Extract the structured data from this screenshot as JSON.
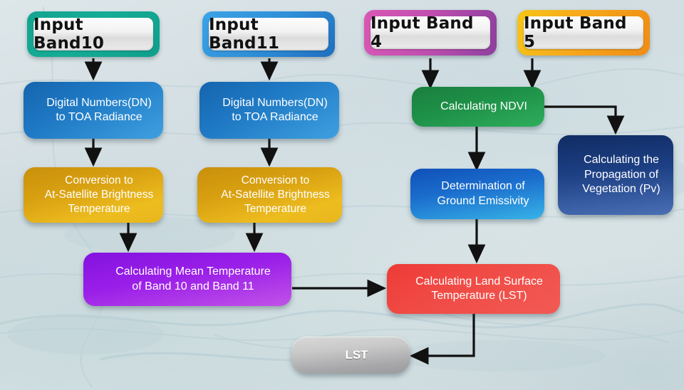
{
  "diagram": {
    "title": "Land Surface Temperature (LST) retrieval workflow",
    "background": "faded satellite basemap, pale blue-gray",
    "colors": {
      "frame_green": "#15ac95",
      "frame_blue": "#2f8fd8",
      "frame_magenta": "#c24fb0",
      "frame_orange": "#f7a81b",
      "node_blue": "#1f79c4",
      "node_gold": "#d79f10",
      "node_purple": "#9a1fe8",
      "node_green": "#1e9148",
      "node_emissivity": "#1a6ccc",
      "node_pv": "#1d3f84",
      "node_red": "#f04a45",
      "node_gray": "#b0b0b2",
      "arrow": "#111111"
    },
    "inputs": [
      {
        "id": "band10",
        "label": "Input Band10",
        "frame": "green"
      },
      {
        "id": "band11",
        "label": "Input Band11",
        "frame": "blue"
      },
      {
        "id": "band4",
        "label": "Input Band 4",
        "frame": "magenta"
      },
      {
        "id": "band5",
        "label": "Input Band 5",
        "frame": "orange"
      }
    ],
    "nodes": [
      {
        "id": "dn10",
        "line1": "Digital Numbers(DN)",
        "line2": "to TOA Radiance",
        "line3": ""
      },
      {
        "id": "dn11",
        "line1": "Digital Numbers(DN)",
        "line2": "to TOA Radiance",
        "line3": ""
      },
      {
        "id": "bt10",
        "line1": "Conversion to",
        "line2": "At-Satellite Brightness",
        "line3": "Temperature"
      },
      {
        "id": "bt11",
        "line1": "Conversion to",
        "line2": "At-Satellite Brightness",
        "line3": "Temperature"
      },
      {
        "id": "ndvi",
        "line1": "Calculating NDVI",
        "line2": "",
        "line3": ""
      },
      {
        "id": "pv",
        "line1": "Calculating the",
        "line2": "Propagation of",
        "line3": "Vegetation (Pv)"
      },
      {
        "id": "emissivity",
        "line1": "Determination of",
        "line2": "Ground Emissivity",
        "line3": ""
      },
      {
        "id": "meantemp",
        "line1": "Calculating Mean Temperature",
        "line2": "of Band 10 and Band 11",
        "line3": ""
      },
      {
        "id": "lstcalc",
        "line1": "Calculating Land Surface",
        "line2": "Temperature (LST)",
        "line3": ""
      },
      {
        "id": "lstout",
        "line1": "LST",
        "line2": "",
        "line3": ""
      }
    ],
    "edges": [
      {
        "from": "band10",
        "to": "dn10",
        "style": "straight-down"
      },
      {
        "from": "band11",
        "to": "dn11",
        "style": "straight-down"
      },
      {
        "from": "band4",
        "to": "ndvi",
        "style": "straight-down"
      },
      {
        "from": "band5",
        "to": "ndvi",
        "style": "straight-down"
      },
      {
        "from": "dn10",
        "to": "bt10",
        "style": "straight-down"
      },
      {
        "from": "dn11",
        "to": "bt11",
        "style": "straight-down"
      },
      {
        "from": "bt10",
        "to": "meantemp",
        "style": "straight-down"
      },
      {
        "from": "bt11",
        "to": "meantemp",
        "style": "straight-down"
      },
      {
        "from": "ndvi",
        "to": "pv",
        "style": "elbow-right-down"
      },
      {
        "from": "ndvi",
        "to": "emissivity",
        "style": "straight-down"
      },
      {
        "from": "emissivity",
        "to": "lstcalc",
        "style": "straight-down"
      },
      {
        "from": "meantemp",
        "to": "lstcalc",
        "style": "straight-right"
      },
      {
        "from": "lstcalc",
        "to": "lstout",
        "style": "elbow-down-left"
      }
    ]
  }
}
